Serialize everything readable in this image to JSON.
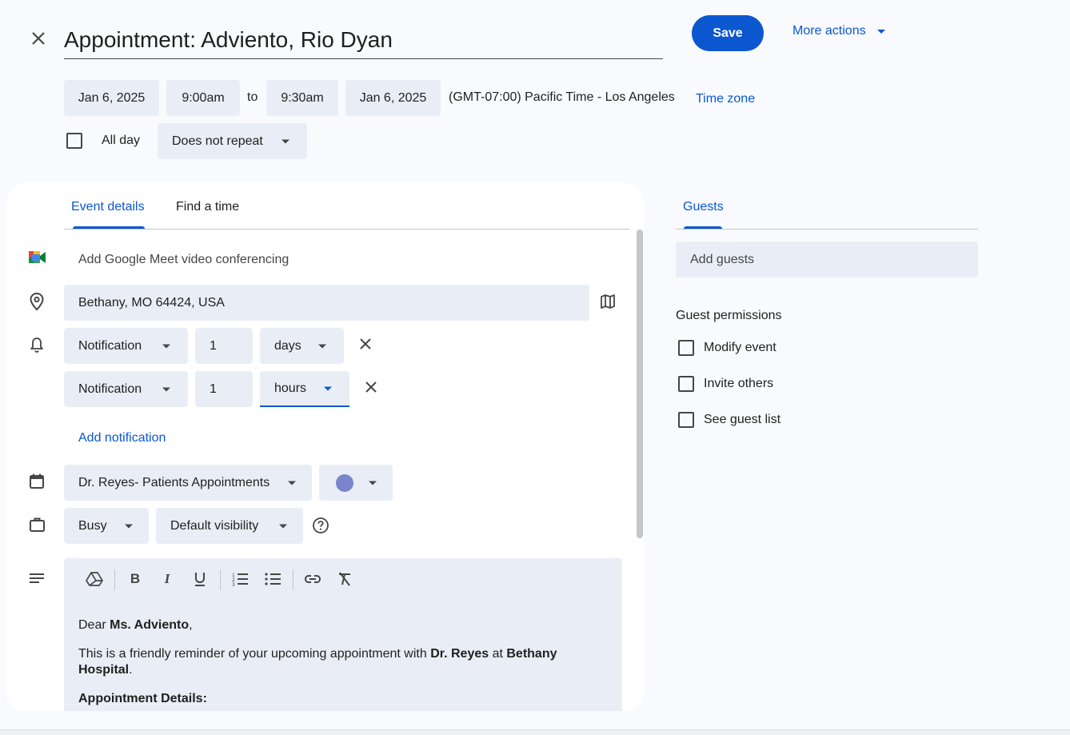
{
  "header": {
    "title": "Appointment: Adviento, Rio Dyan",
    "save_label": "Save",
    "more_actions_label": "More actions"
  },
  "datetime": {
    "start_date": "Jan 6, 2025",
    "start_time": "9:00am",
    "to_label": "to",
    "end_time": "9:30am",
    "end_date": "Jan 6, 2025",
    "timezone_text": "(GMT-07:00) Pacific Time - Los Angeles",
    "timezone_link": "Time zone",
    "all_day_label": "All day",
    "repeat_value": "Does not repeat"
  },
  "tabs": {
    "event_details": "Event details",
    "find_a_time": "Find a time"
  },
  "details": {
    "meet_label": "Add Google Meet video conferencing",
    "location_value": "Bethany, MO 64424, USA",
    "notifications": [
      {
        "type": "Notification",
        "amount": "1",
        "unit": "days"
      },
      {
        "type": "Notification",
        "amount": "1",
        "unit": "hours"
      }
    ],
    "add_notification_label": "Add notification",
    "calendar_value": "Dr. Reyes- Patients Appointments",
    "calendar_color": "#7986cb",
    "availability_value": "Busy",
    "visibility_value": "Default visibility"
  },
  "description": {
    "greeting_prefix": "Dear ",
    "greeting_name": "Ms. Adviento",
    "greeting_suffix": ",",
    "line2_prefix": "This is a friendly reminder of your upcoming appointment with ",
    "line2_doctor": "Dr. Reyes",
    "line2_mid": " at ",
    "line2_place1": "Bethany",
    "line2_place2": "Hospital",
    "line2_suffix": ".",
    "details_heading": "Appointment Details:"
  },
  "guests": {
    "tab_label": "Guests",
    "add_placeholder": "Add guests",
    "permissions_heading": "Guest permissions",
    "permissions": [
      {
        "label": "Modify event"
      },
      {
        "label": "Invite others"
      },
      {
        "label": "See guest list"
      }
    ]
  },
  "colors": {
    "accent": "#0b57d0",
    "chip_bg": "#e9eef6",
    "page_bg": "#f8fafd"
  }
}
